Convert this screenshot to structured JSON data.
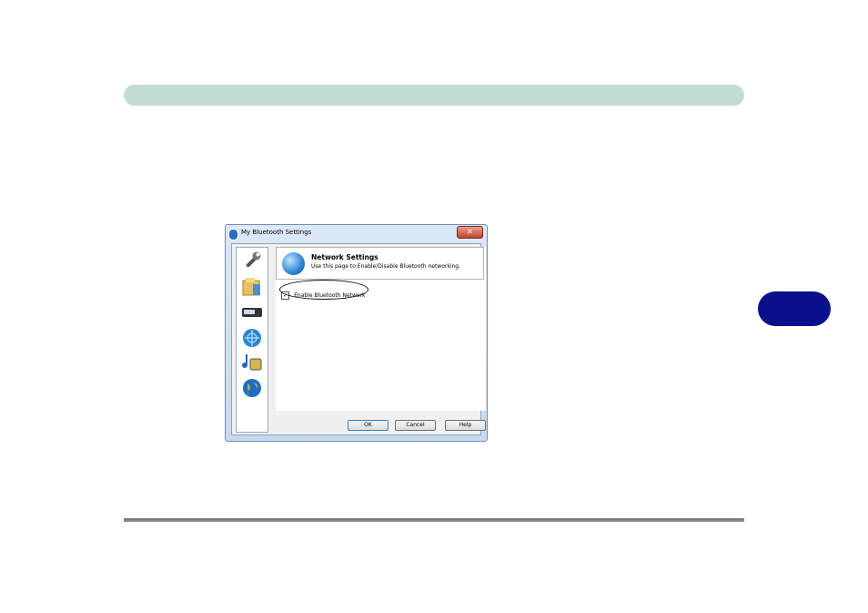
{
  "dialog": {
    "title": "My Bluetooth Settings",
    "close_symbol": "✕",
    "sidebar_icons": [
      "wrench-icon",
      "folder-icon",
      "device-icon",
      "network-globe-icon",
      "music-icon",
      "globe-icon"
    ],
    "panel": {
      "title": "Network Settings",
      "subtitle": "Use this page to Enable/Disable Bluetooth networking."
    },
    "enable_checkbox": {
      "label": "Enable Bluetooth Network",
      "checked": true,
      "mark": "✓"
    },
    "buttons": {
      "ok": "OK",
      "cancel": "Cancel",
      "help": "Help"
    }
  },
  "colors": {
    "header_bar": "#c3dcd5",
    "chapter_tab": "#0a0f8c"
  }
}
